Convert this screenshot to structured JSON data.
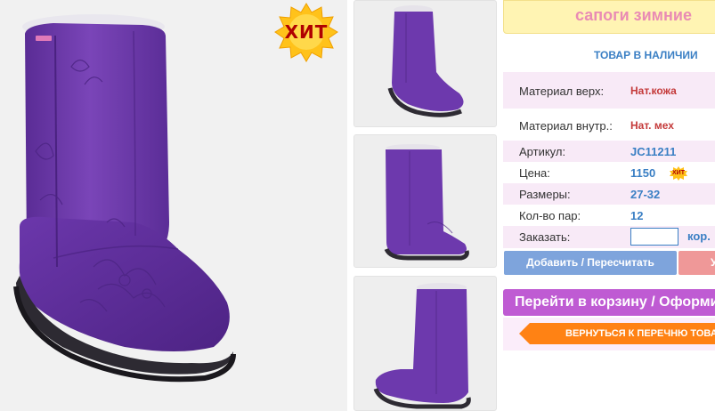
{
  "badge": {
    "hit_label": "ХИТ",
    "mini_hit_label": "ХИТ"
  },
  "product": {
    "title": "сапоги зимние",
    "stock_status": "ТОВАР В НАЛИЧИИ"
  },
  "specs": {
    "material_outer_label": "Материал верх:",
    "material_outer_value": "Нат.кожа",
    "material_inner_label": "Материал внутр.:",
    "material_inner_value": "Нат. мех",
    "article_label": "Артикул:",
    "article_value": "JC11211",
    "price_label": "Цена:",
    "price_value": "1150",
    "sizes_label": "Размеры:",
    "sizes_value": "27-32",
    "pairs_label": "Кол-во пар:",
    "pairs_value": "12",
    "order_label": "Заказать:",
    "order_input_value": "",
    "order_unit": "кор."
  },
  "actions": {
    "add_recalc_label": "Добавить / Пересчитать",
    "second_button_label": "У",
    "go_to_cart_label": "Перейти в корзину / Оформить",
    "back_to_list_label": "ВЕРНУТЬСЯ К ПЕРЕЧНЮ ТОВАРОВ"
  },
  "colors": {
    "boot_purple": "#6a36a8",
    "link_blue": "#3a7fc4",
    "cart_purple": "#bf5bd3",
    "back_orange": "#ff8214",
    "title_pink": "#e98bb4"
  }
}
